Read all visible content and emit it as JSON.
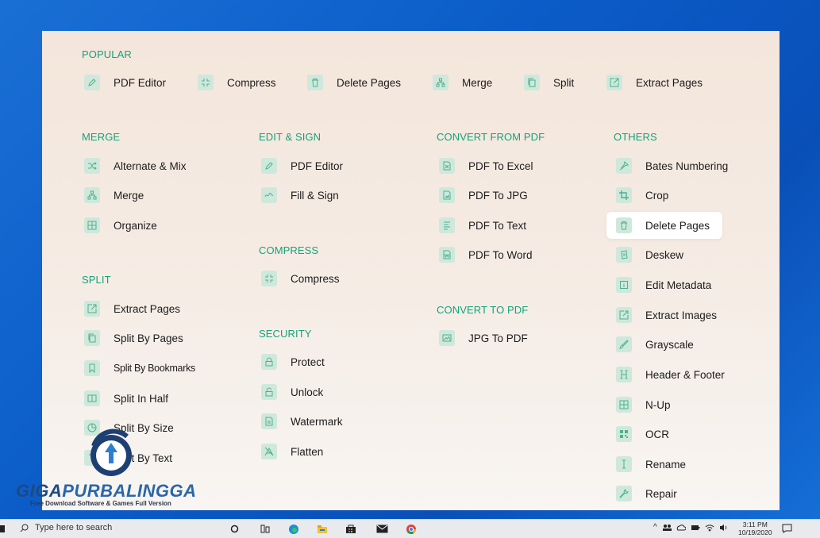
{
  "sections": {
    "popular": "POPULAR",
    "merge": "MERGE",
    "edit_sign": "EDIT & SIGN",
    "convert_from_pdf": "CONVERT FROM PDF",
    "others": "OTHERS",
    "compress": "COMPRESS",
    "split": "SPLIT",
    "convert_to_pdf": "CONVERT TO PDF",
    "security": "SECURITY"
  },
  "popular": [
    "PDF Editor",
    "Compress",
    "Delete Pages",
    "Merge",
    "Split",
    "Extract Pages"
  ],
  "merge": [
    "Alternate & Mix",
    "Merge",
    "Organize"
  ],
  "split": [
    "Extract Pages",
    "Split By Pages",
    "Split By Bookmarks",
    "Split In Half",
    "Split By Size",
    "Split By Text"
  ],
  "edit_sign": [
    "PDF Editor",
    "Fill & Sign"
  ],
  "compress": [
    "Compress"
  ],
  "security": [
    "Protect",
    "Unlock",
    "Watermark",
    "Flatten"
  ],
  "convert_from_pdf": [
    "PDF To Excel",
    "PDF To JPG",
    "PDF To Text",
    "PDF To Word"
  ],
  "convert_to_pdf": [
    "JPG To PDF"
  ],
  "others": [
    "Bates Numbering",
    "Crop",
    "Delete Pages",
    "Deskew",
    "Edit Metadata",
    "Extract Images",
    "Grayscale",
    "Header & Footer",
    "N-Up",
    "OCR",
    "Rename",
    "Repair"
  ],
  "highlighted_tool": "Delete Pages",
  "taskbar": {
    "search_placeholder": "Type here to search",
    "time": "3:11 PM",
    "date": "10/19/2020"
  },
  "watermark": {
    "title_a": "GIGA",
    "title_b": "PURBALINGGA",
    "subtitle": "Free Download Software & Games Full Version"
  },
  "colors": {
    "accent": "#13a37c",
    "icon_bg": "#cfe8dc",
    "desktop": "#0b5cc8"
  }
}
